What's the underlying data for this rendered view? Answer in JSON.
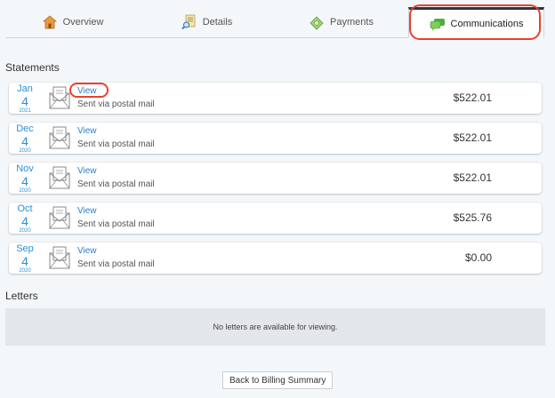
{
  "tabs": [
    {
      "label": "Overview",
      "icon": "house-icon"
    },
    {
      "label": "Details",
      "icon": "document-magnifier-icon"
    },
    {
      "label": "Payments",
      "icon": "money-icon"
    },
    {
      "label": "Communications",
      "icon": "chat-bubbles-icon",
      "active": true
    }
  ],
  "statements": {
    "title": "Statements",
    "items": [
      {
        "month": "Jan",
        "day": "4",
        "year": "2021",
        "link": "View",
        "delivery": "Sent via postal mail",
        "amount": "$522.01"
      },
      {
        "month": "Dec",
        "day": "4",
        "year": "2020",
        "link": "View",
        "delivery": "Sent via postal mail",
        "amount": "$522.01"
      },
      {
        "month": "Nov",
        "day": "4",
        "year": "2020",
        "link": "View",
        "delivery": "Sent via postal mail",
        "amount": "$522.01"
      },
      {
        "month": "Oct",
        "day": "4",
        "year": "2020",
        "link": "View",
        "delivery": "Sent via postal mail",
        "amount": "$525.76"
      },
      {
        "month": "Sep",
        "day": "4",
        "year": "2020",
        "link": "View",
        "delivery": "Sent via postal mail",
        "amount": "$0.00"
      }
    ]
  },
  "letters": {
    "title": "Letters",
    "empty_message": "No letters are available for viewing."
  },
  "back_button": "Back to Billing Summary",
  "colors": {
    "accent_blue": "#2a8fd6",
    "highlight_red": "#e8402f",
    "active_tab_border": "#2b3440"
  }
}
